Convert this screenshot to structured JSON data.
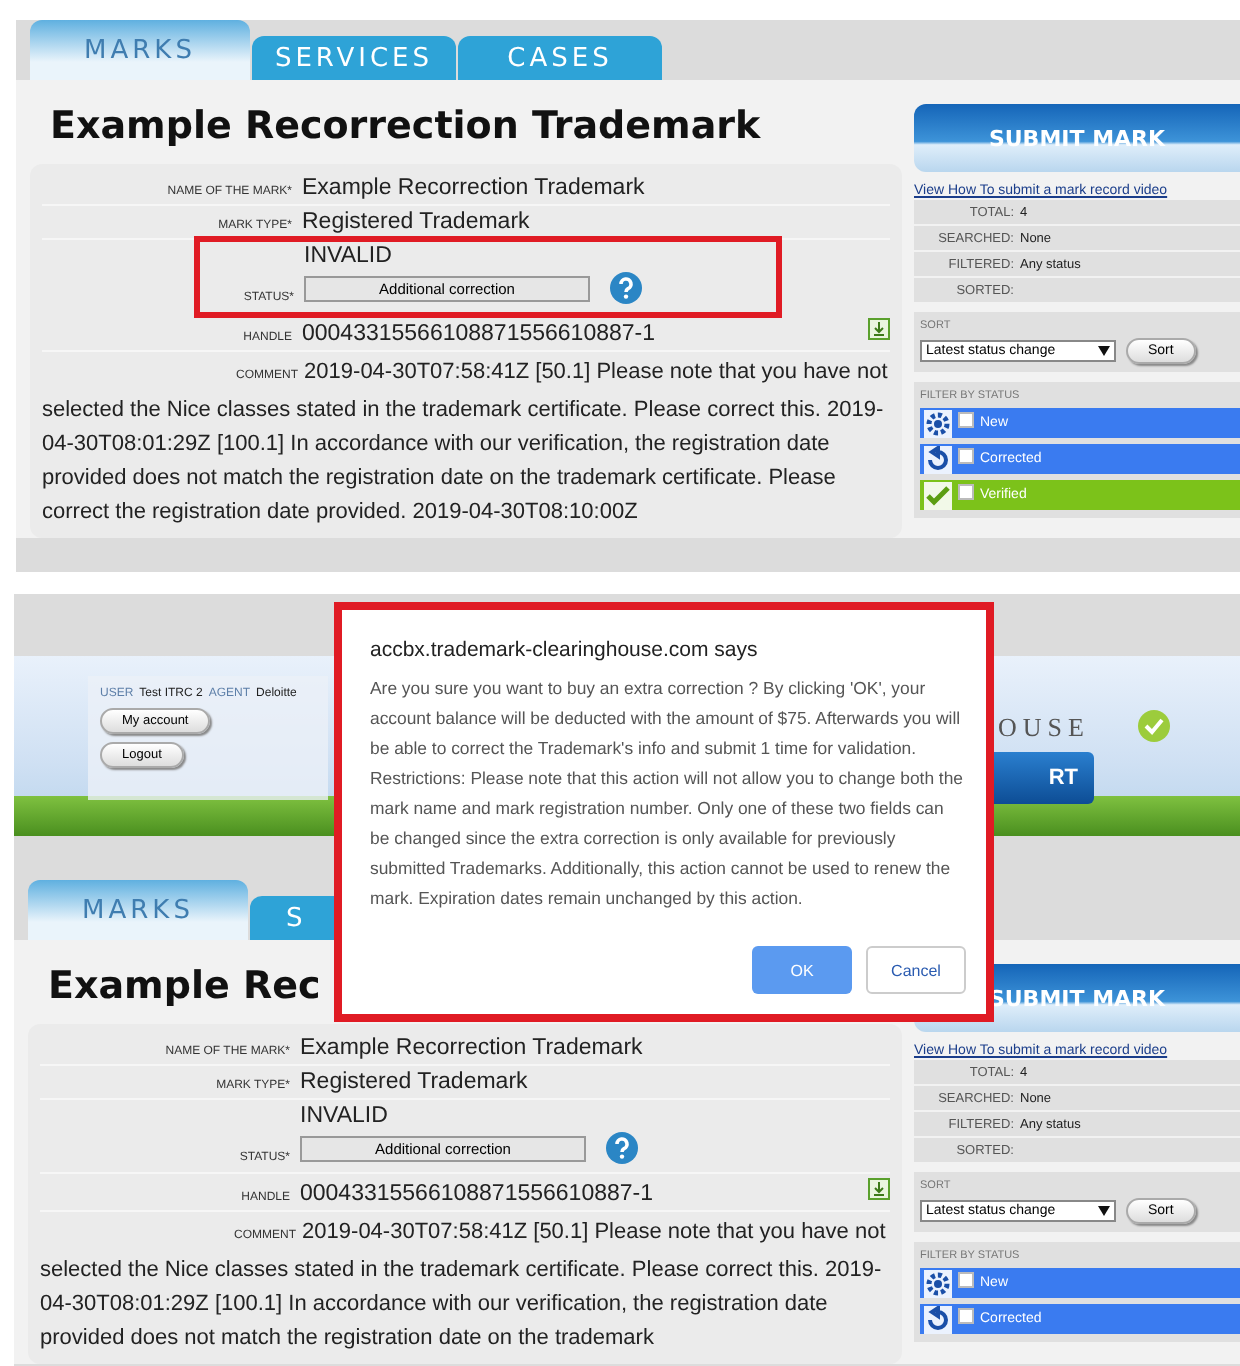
{
  "screens": [
    {
      "tabs": [
        {
          "label": "MARKS",
          "selected": true
        },
        {
          "label": "SERVICES",
          "selected": false
        },
        {
          "label": "CASES",
          "selected": false
        }
      ],
      "title": "Example Recorrection Trademark",
      "form": [
        {
          "kind": "text",
          "label": "NAME OF THE MARK*",
          "value": "Example Recorrection Trademark"
        },
        {
          "kind": "text",
          "label": "MARK TYPE*",
          "value": "Registered Trademark"
        },
        {
          "kind": "status",
          "label": "STATUS*",
          "value": "INVALID",
          "button": "Additional correction",
          "highlighted": true
        },
        {
          "kind": "handle",
          "label": "HANDLE",
          "value": "00043315566108871556610887-1"
        },
        {
          "kind": "comment",
          "label": "COMMENT",
          "value": "2019-04-30T07:58:41Z [50.1] Please note that you have not selected the Nice classes stated in the trademark certificate. Please correct this. 2019-04-30T08:01:29Z [100.1] In accordance with our verification, the registration date provided does not match the registration date on the trademark certificate. Please correct the registration date provided. 2019-04-30T08:10:00Z"
        }
      ],
      "sidebar": {
        "button": "SUBMIT MARK",
        "link": "View How To submit a mark record video",
        "stats": [
          {
            "label": "TOTAL:",
            "value": "4"
          },
          {
            "label": "SEARCHED:",
            "value": "None"
          },
          {
            "label": "FILTERED:",
            "value": "Any status"
          },
          {
            "label": "SORTED:"
          }
        ],
        "sort": {
          "label": "SORT",
          "select": "Latest status change",
          "button": "Sort"
        },
        "filter": {
          "label": "FILTER BY STATUS",
          "items": [
            {
              "kind": "new",
              "label": "New",
              "color": "#3a7bf0",
              "checked": false
            },
            {
              "kind": "corrected",
              "label": "Corrected",
              "color": "#3a7bf0",
              "checked": false
            },
            {
              "kind": "verified",
              "label": "Verified",
              "color": "#7cc21a",
              "checked": false
            }
          ]
        }
      }
    },
    {
      "header": {
        "user_label": "USER",
        "user": "Test ITRC 2",
        "agent_label": "AGENT",
        "agent": "Deloitte",
        "buttons": [
          "My account",
          "Logout"
        ],
        "logo": "OUSE",
        "banner_button": "RT"
      },
      "tabs": [
        {
          "label": "MARKS",
          "selected": true
        },
        {
          "label": "S",
          "selected": false
        }
      ],
      "title": "Example Rec",
      "form": [
        {
          "kind": "text",
          "label": "NAME OF THE MARK*",
          "value": "Example Recorrection Trademark"
        },
        {
          "kind": "text",
          "label": "MARK TYPE*",
          "value": "Registered Trademark"
        },
        {
          "kind": "status",
          "label": "STATUS*",
          "value": "INVALID",
          "button": "Additional correction",
          "highlighted": false
        },
        {
          "kind": "handle",
          "label": "HANDLE",
          "value": "00043315566108871556610887-1"
        },
        {
          "kind": "comment",
          "label": "COMMENT",
          "value": "2019-04-30T07:58:41Z [50.1] Please note that you have not selected the Nice classes stated in the trademark certificate. Please correct this. 2019-04-30T08:01:29Z [100.1] In accordance with our verification, the registration date provided does not match the registration date on the trademark"
        }
      ],
      "sidebar": {
        "button": "SUBMIT MARK",
        "link": "View How To submit a mark record video",
        "stats": [
          {
            "label": "TOTAL:",
            "value": "4"
          },
          {
            "label": "SEARCHED:",
            "value": "None"
          },
          {
            "label": "FILTERED:",
            "value": "Any status"
          },
          {
            "label": "SORTED:"
          }
        ],
        "sort": {
          "label": "SORT",
          "select": "Latest status change",
          "button": "Sort"
        },
        "filter": {
          "label": "FILTER BY STATUS",
          "items": [
            {
              "kind": "new",
              "label": "New",
              "color": "#3a7bf0",
              "checked": false
            },
            {
              "kind": "corrected",
              "label": "Corrected",
              "color": "#3a7bf0",
              "checked": false
            }
          ]
        }
      },
      "dialog": {
        "title": "accbx.trademark-clearinghouse.com says",
        "message": "Are you sure you want to buy an extra correction ? By clicking 'OK', your account balance will be deducted with the amount of $75. Afterwards you will be able to correct the Trademark's info and submit 1 time for validation. Restrictions: Please note that this action will not allow you to change both the mark name and mark registration number. Only one of these two fields can be changed since the extra correction is only available for previously submitted Trademarks. Additionally, this action cannot be used to renew the mark. Expiration dates remain unchanged by this action.",
        "buttons": [
          {
            "label": "OK",
            "kind": "primary"
          },
          {
            "label": "Cancel",
            "kind": "secondary"
          }
        ]
      }
    }
  ]
}
